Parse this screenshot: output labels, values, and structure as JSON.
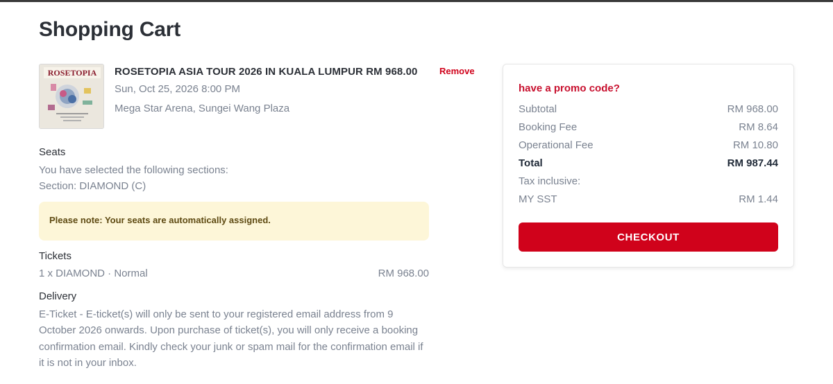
{
  "page": {
    "title": "Shopping Cart"
  },
  "event": {
    "title": "ROSETOPIA ASIA TOUR 2026 IN KUALA LUMPUR RM 968.00",
    "remove_label": "Remove",
    "datetime": "Sun, Oct 25, 2026 8:00 PM",
    "venue": "Mega Star Arena, Sungei Wang Plaza",
    "thumbnail_text": "ROSETOPIA"
  },
  "seats": {
    "heading": "Seats",
    "intro": "You have selected the following sections:",
    "section": "Section: DIAMOND (C)"
  },
  "note": {
    "text": "Please note: Your seats are automatically assigned."
  },
  "tickets": {
    "heading": "Tickets",
    "line": "1 x DIAMOND · Normal",
    "price": "RM 968.00"
  },
  "delivery": {
    "heading": "Delivery",
    "text": "E-Ticket - E-ticket(s) will only be sent to your registered email address from 9 October 2026 onwards. Upon purchase of ticket(s), you will only receive a booking confirmation email. Kindly check your junk or spam mail for the confirmation email if it is not in your inbox."
  },
  "summary": {
    "promo_label": "have a promo code?",
    "rows": [
      {
        "label": "Subtotal",
        "value": "RM 968.00"
      },
      {
        "label": "Booking Fee",
        "value": "RM 8.64"
      },
      {
        "label": "Operational Fee",
        "value": "RM 10.80"
      },
      {
        "label": "Total",
        "value": "RM 987.44"
      },
      {
        "label": "Tax inclusive:",
        "value": ""
      },
      {
        "label": "MY SST",
        "value": "RM 1.44"
      }
    ],
    "checkout_label": "CHECKOUT"
  },
  "colors": {
    "accent_red": "#d0021b",
    "note_background": "#fdf6d8",
    "muted_text": "#7a8290"
  }
}
